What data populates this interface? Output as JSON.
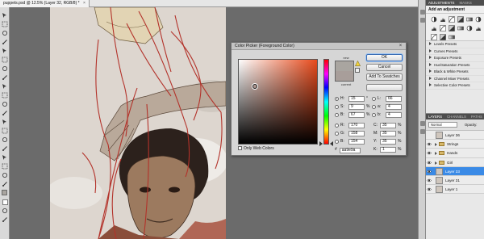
{
  "document": {
    "tab_title": "puppets.psd @ 12.5% (Layer 32, RGB/8) *",
    "close_label": "×"
  },
  "tools": [
    "move-tool",
    "marquee-tool",
    "lasso-tool",
    "quick-select-tool",
    "crop-tool",
    "eyedropper-tool",
    "healing-tool",
    "brush-tool",
    "stamp-tool",
    "history-brush-tool",
    "eraser-tool",
    "gradient-tool",
    "blur-tool",
    "dodge-tool",
    "pen-tool",
    "type-tool",
    "path-select-tool",
    "shape-tool",
    "hand-tool",
    "zoom-tool",
    "foreground-color",
    "background-color",
    "quick-mask",
    "screen-mode"
  ],
  "color_picker": {
    "title": "Color Picker (Foreground Color)",
    "close_label": "×",
    "new_label": "new",
    "current_label": "current",
    "new_color": "#a9a5a0",
    "current_color": "#a89e9a",
    "buttons": {
      "ok": "OK",
      "cancel": "Cancel",
      "add_to_swatches": "Add To Swatches",
      "color_libraries": "Color Libraries"
    },
    "hsb": [
      {
        "label": "H:",
        "value": "15",
        "unit": "°",
        "selected": true
      },
      {
        "label": "S:",
        "value": "9",
        "unit": "%",
        "selected": false
      },
      {
        "label": "B:",
        "value": "67",
        "unit": "%",
        "selected": false
      }
    ],
    "rgb": [
      {
        "label": "R:",
        "value": "170",
        "selected": false
      },
      {
        "label": "G:",
        "value": "158",
        "selected": false
      },
      {
        "label": "B:",
        "value": "154",
        "selected": false
      }
    ],
    "lab": [
      {
        "label": "L:",
        "value": "66"
      },
      {
        "label": "a:",
        "value": "4"
      },
      {
        "label": "b:",
        "value": "4"
      }
    ],
    "cmyk": [
      {
        "label": "C:",
        "value": "35",
        "unit": "%"
      },
      {
        "label": "M:",
        "value": "35",
        "unit": "%"
      },
      {
        "label": "Y:",
        "value": "35",
        "unit": "%"
      },
      {
        "label": "K:",
        "value": "1",
        "unit": "%"
      }
    ],
    "only_web_colors": "Only Web Colors",
    "hex_label": "#",
    "hex_value": "aa9e9a"
  },
  "adjustments": {
    "tabs": [
      "ADJUSTMENTS",
      "MASKS"
    ],
    "heading": "Add an adjustment",
    "icons": [
      "brightness-contrast-icon",
      "levels-icon",
      "curves-icon",
      "exposure-icon",
      "vibrance-icon",
      "hue-saturation-icon",
      "color-balance-icon",
      "black-white-icon",
      "photo-filter-icon",
      "channel-mixer-icon",
      "invert-icon",
      "posterize-icon",
      "threshold-icon",
      "gradient-map-icon",
      "selective-color-icon"
    ],
    "presets": [
      "Levels Presets",
      "Curves Presets",
      "Exposure Presets",
      "Hue/Saturation Presets",
      "Black & White Presets",
      "Channel Mixer Presets",
      "Selective Color Presets"
    ]
  },
  "layers": {
    "tabs": [
      "LAYERS",
      "CHANNELS",
      "PATHS"
    ],
    "blend_mode": "Normal",
    "opacity_label": "Opacity:",
    "rows": [
      {
        "name": "Layer 36",
        "type": "layer",
        "selected": false,
        "visible": false
      },
      {
        "name": "Strings",
        "type": "group",
        "selected": false,
        "visible": true
      },
      {
        "name": "Hands",
        "type": "group",
        "selected": false,
        "visible": true
      },
      {
        "name": "Girl",
        "type": "group",
        "selected": false,
        "visible": true
      },
      {
        "name": "Layer 33",
        "type": "layer",
        "selected": true,
        "visible": true
      },
      {
        "name": "Layer 31",
        "type": "layer",
        "selected": false,
        "visible": true
      },
      {
        "name": "Layer 1",
        "type": "layer",
        "selected": false,
        "visible": true
      }
    ]
  },
  "colors": {
    "accent": "#3a8ae6",
    "string_red": "#b3322a",
    "panel_bg": "#e8e8e8"
  }
}
